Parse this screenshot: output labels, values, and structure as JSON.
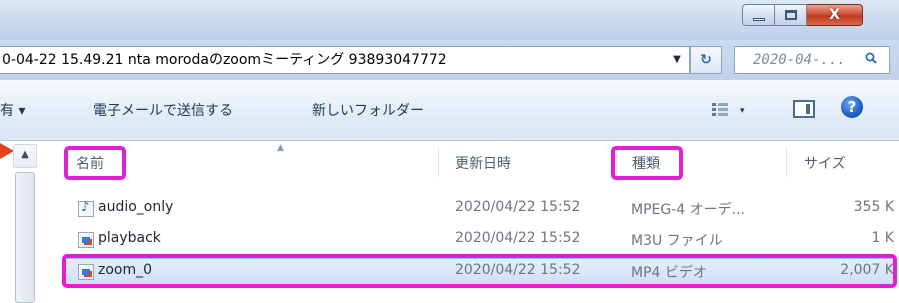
{
  "window": {
    "controls": {
      "minimize_icon": "minimize-icon",
      "maximize_icon": "maximize-icon",
      "close_glyph": "X"
    }
  },
  "address_bar": {
    "path": "0-04-22 15.49.21 nta morodaのzoomミーティング 93893047772",
    "dropdown_glyph": "▼",
    "refresh_glyph": "↻",
    "search_placeholder": "2020-04-... "
  },
  "toolbar": {
    "organize_partial": "有 ▾",
    "email": "電子メールで送信する",
    "new_folder": "新しいフォルダー",
    "views_arrow": "▾",
    "help": "?"
  },
  "columns": {
    "name": "名前",
    "date": "更新日時",
    "type": "種類",
    "size": "サイズ"
  },
  "files": [
    {
      "name": "audio_only",
      "date": "2020/04/22 15:52",
      "type": "MPEG-4 オーデ...",
      "size": "355 K",
      "icon": "audio-file-icon"
    },
    {
      "name": "playback",
      "date": "2020/04/22 15:52",
      "type": "M3U ファイル",
      "size": "1 K",
      "icon": "playlist-file-icon"
    },
    {
      "name": "zoom_0",
      "date": "2020/04/22 15:52",
      "type": "MP4 ビデオ",
      "size": "2,007 K",
      "icon": "video-file-icon"
    }
  ],
  "colors": {
    "highlight": "#e21fd6",
    "arrow": "#e2421c",
    "selection": "#cfe0f6"
  }
}
